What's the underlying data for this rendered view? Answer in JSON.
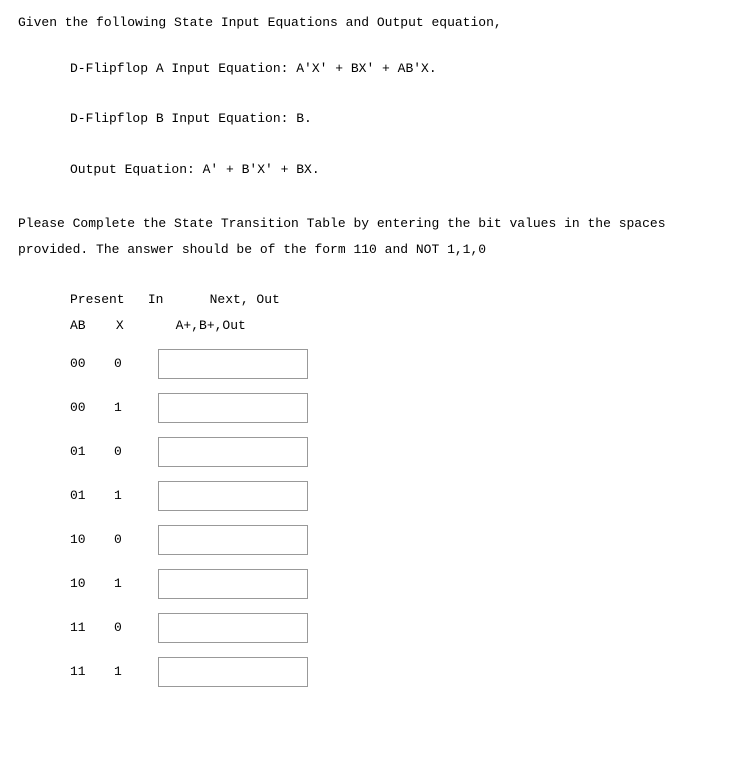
{
  "intro": "Given the following State Input Equations and Output equation,",
  "equations": {
    "da": "D-Flipflop A Input Equation: A'X' + BX' + AB'X.",
    "db": "D-Flipflop B Input Equation: B.",
    "out": "Output Equation: A' + B'X' + BX."
  },
  "instructions": "Please Complete the State Transition Table by entering the bit values in the spaces provided. The answer should be of the form 110 and NOT 1,1,0",
  "headers": {
    "present": "Present",
    "in": "In",
    "next_out": "Next, Out",
    "ab": "AB",
    "x": "X",
    "abo": "A+,B+,Out"
  },
  "rows": [
    {
      "ab": "00",
      "x": "0",
      "val": ""
    },
    {
      "ab": "00",
      "x": "1",
      "val": ""
    },
    {
      "ab": "01",
      "x": "0",
      "val": ""
    },
    {
      "ab": "01",
      "x": "1",
      "val": ""
    },
    {
      "ab": "10",
      "x": "0",
      "val": ""
    },
    {
      "ab": "10",
      "x": "1",
      "val": ""
    },
    {
      "ab": "11",
      "x": "0",
      "val": ""
    },
    {
      "ab": "11",
      "x": "1",
      "val": ""
    }
  ]
}
